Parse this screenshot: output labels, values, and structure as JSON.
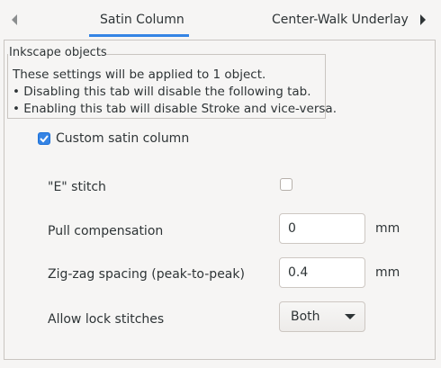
{
  "tabs": [
    {
      "label": "Satin Column",
      "active": true
    },
    {
      "label": "Center-Walk Underlay",
      "active": false
    }
  ],
  "info": {
    "frame_title": "Inkscape objects",
    "lines": [
      "These settings will be applied to 1 object.",
      "• Disabling this tab will disable the following tab.",
      "• Enabling this tab will disable Stroke and vice-versa."
    ]
  },
  "custom_satin": {
    "label": "Custom satin column",
    "checked": true
  },
  "params": {
    "e_stitch": {
      "label": "\"E\" stitch",
      "checked": false
    },
    "pull_comp": {
      "label": "Pull compensation",
      "value": "0",
      "unit": "mm"
    },
    "zigzag": {
      "label": "Zig-zag spacing (peak-to-peak)",
      "value": "0.4",
      "unit": "mm"
    },
    "lock": {
      "label": "Allow lock stitches",
      "selected": "Both"
    }
  },
  "colors": {
    "accent": "#3584e4",
    "text": "#2e3436",
    "background": "#f6f5f4"
  }
}
